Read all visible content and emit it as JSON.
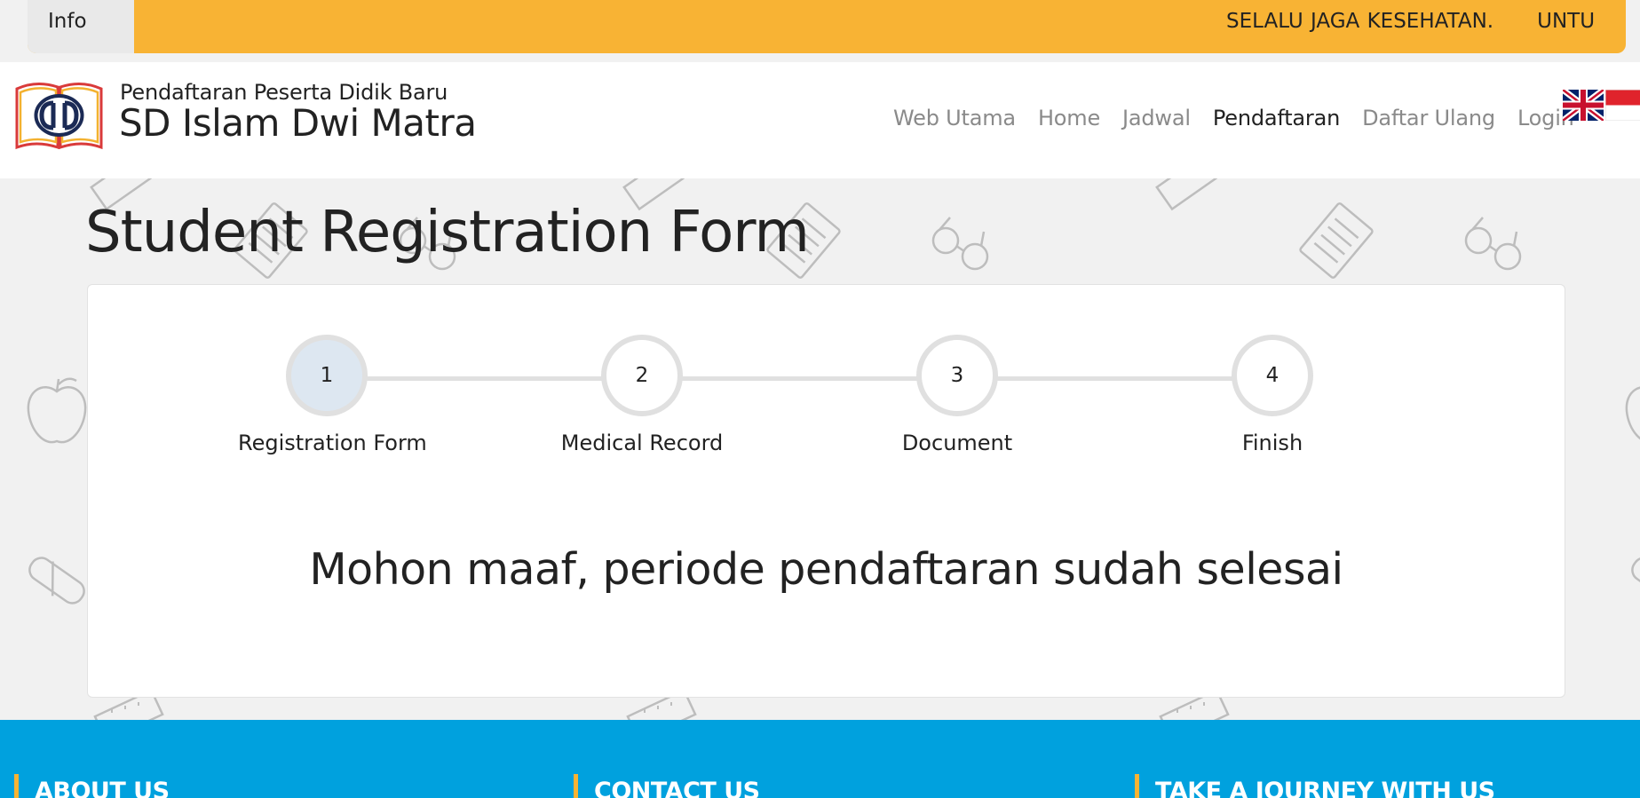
{
  "info_bar": {
    "tab_label": "Info",
    "ticker_items": [
      "SELALU JAGA KESEHATAN.",
      "UNTU"
    ]
  },
  "header": {
    "brand_subtitle": "Pendaftaran Peserta Didik Baru",
    "brand_title": "SD Islam Dwi Matra",
    "nav": [
      {
        "label": "Web Utama",
        "active": false
      },
      {
        "label": "Home",
        "active": false
      },
      {
        "label": "Jadwal",
        "active": false
      },
      {
        "label": "Pendaftaran",
        "active": true
      },
      {
        "label": "Daftar Ulang",
        "active": false
      },
      {
        "label": "Login",
        "active": false
      }
    ]
  },
  "page": {
    "title": "Student Registration Form"
  },
  "stepper": {
    "steps": [
      {
        "number": "1",
        "label": "Registration Form",
        "active": true
      },
      {
        "number": "2",
        "label": "Medical Record",
        "active": false
      },
      {
        "number": "3",
        "label": "Document",
        "active": false
      },
      {
        "number": "4",
        "label": "Finish",
        "active": false
      }
    ]
  },
  "message": "Mohon maaf, periode pendaftaran sudah selesai",
  "footer": {
    "columns": [
      "ABOUT US",
      "CONTACT US",
      "TAKE A JOURNEY WITH US"
    ]
  },
  "colors": {
    "accent_yellow": "#f8b334",
    "footer_blue": "#00a1de",
    "active_step": "#dde7f1",
    "logo_navy": "#1b2a55"
  }
}
